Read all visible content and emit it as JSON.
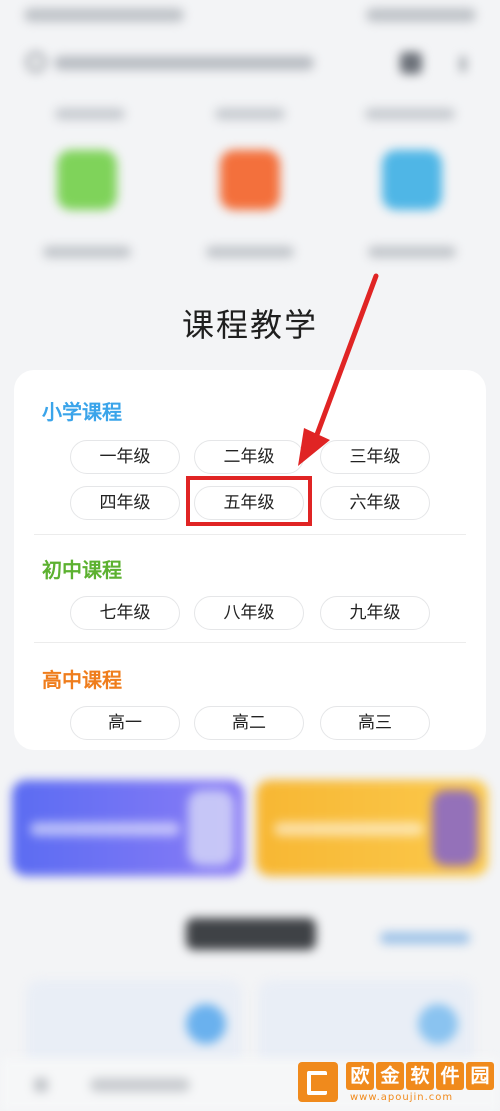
{
  "section_title": "课程教学",
  "categories": [
    {
      "title": "小学课程",
      "grades": [
        "一年级",
        "二年级",
        "三年级",
        "四年级",
        "五年级",
        "六年级"
      ]
    },
    {
      "title": "初中课程",
      "grades": [
        "七年级",
        "八年级",
        "九年级"
      ]
    },
    {
      "title": "高中课程",
      "grades": [
        "高一",
        "高二",
        "高三"
      ]
    }
  ],
  "annotation": {
    "highlighted_grade": "五年级",
    "color": "#e02424"
  },
  "colors": {
    "primary": "#3aa4ea",
    "middle": "#5cb130",
    "high": "#ef7d1c",
    "watermark": "#f08a1c"
  },
  "watermark": {
    "chars": [
      "欧",
      "金",
      "软",
      "件",
      "园"
    ],
    "url": "www.apoujin.com"
  }
}
